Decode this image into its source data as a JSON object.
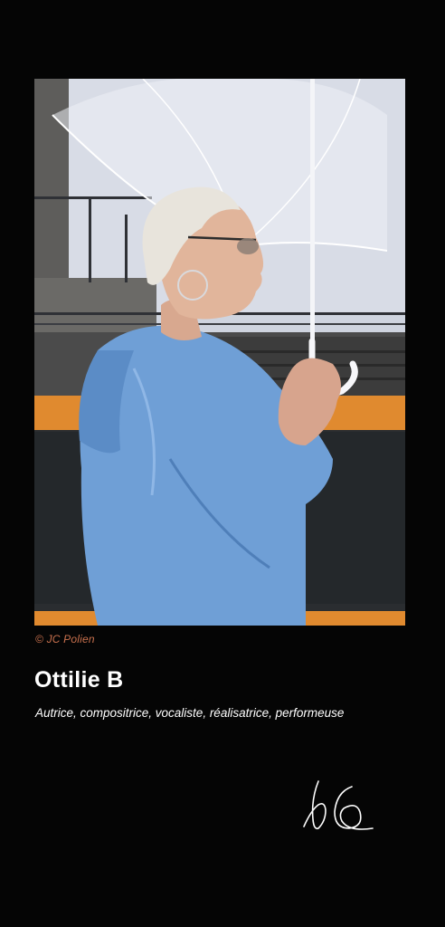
{
  "photo": {
    "subject": "portrait-photo",
    "colors": {
      "sky": "#cfd4df",
      "jacket": "#6f9fd6",
      "car": "#e08a2f",
      "stone": "#6d6d6d"
    }
  },
  "credit": "© JC Polien",
  "artist": {
    "name": "Ottilie B",
    "roles": "Autrice, compositrice, vocaliste,  réalisatrice, performeuse"
  },
  "colors": {
    "background": "#050505",
    "credit": "#c9714e",
    "text": "#ffffff"
  }
}
